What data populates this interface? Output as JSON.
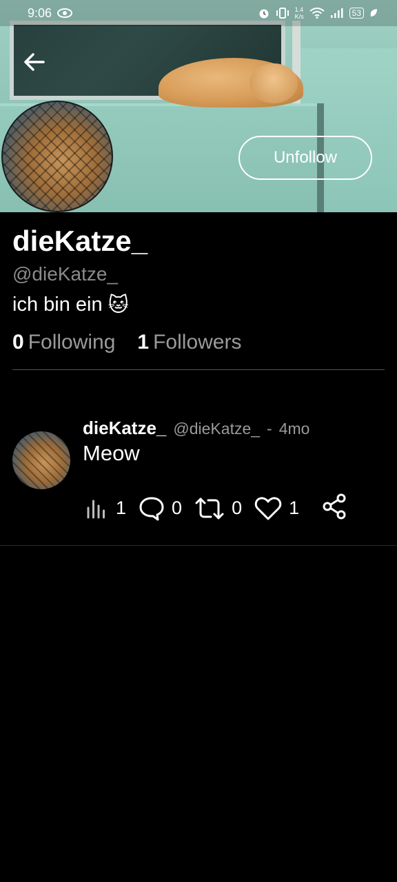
{
  "status_bar": {
    "time": "9:06",
    "net_speed": "1.4",
    "net_unit": "K/s",
    "battery": "53"
  },
  "header": {
    "unfollow_label": "Unfollow"
  },
  "profile": {
    "display_name": "dieKatze_",
    "handle": "@dieKatze_",
    "bio": "ich bin ein",
    "bio_emoji": "🐱",
    "following_count": "0",
    "following_label": "Following",
    "followers_count": "1",
    "followers_label": "Followers"
  },
  "post": {
    "author_name": "dieKatze_",
    "author_handle": "@dieKatze_",
    "separator": "-",
    "age": "4mo",
    "text": "Meow",
    "views": "1",
    "replies": "0",
    "reposts": "0",
    "likes": "1"
  },
  "icons": [
    "back-arrow-icon",
    "eye-icon",
    "alarm-icon",
    "vibrate-icon",
    "wifi-icon",
    "signal-icon",
    "battery-icon",
    "leaf-icon",
    "views-icon",
    "reply-icon",
    "repost-icon",
    "heart-icon",
    "share-icon"
  ]
}
